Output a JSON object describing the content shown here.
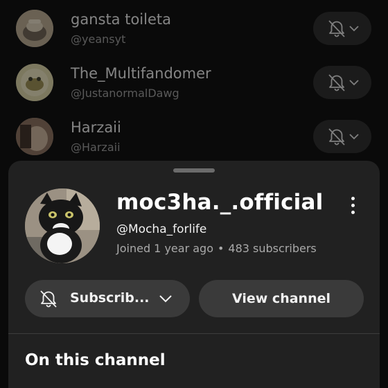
{
  "subscriptions": [
    {
      "name": "gansta toileta",
      "handle": "@yeansyt"
    },
    {
      "name": "The_Multifandomer",
      "handle": "@JustanormalDawg"
    },
    {
      "name": "Harzaii",
      "handle": "@Harzaii"
    }
  ],
  "channel": {
    "name": "moc3ha._.official",
    "handle": "@Mocha_forlife",
    "joined": "Joined 1 year ago",
    "separator": "•",
    "subscribers": "483 subscribers"
  },
  "actions": {
    "subscribe_label": "Subscrib...",
    "view_label": "View channel"
  },
  "section": {
    "title": "On this channel"
  },
  "colors": {
    "sheet_background": "#212121",
    "page_background": "#0a0a0a",
    "button_background": "#3a3a3a"
  },
  "icons": {
    "notification": "bell-off-icon",
    "dropdown": "chevron-down-icon",
    "more": "more-vertical-icon"
  }
}
